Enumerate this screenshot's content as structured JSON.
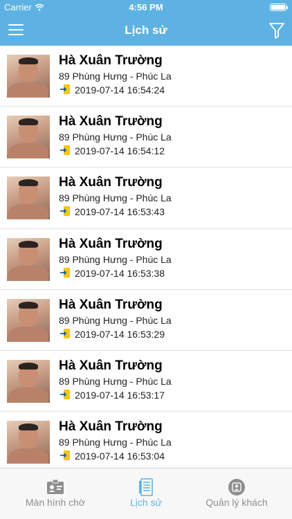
{
  "status_bar": {
    "carrier": "Carrier",
    "time": "4:56 PM"
  },
  "nav": {
    "title": "Lịch sử",
    "menu_icon": "hamburger-menu-icon",
    "filter_icon": "filter-funnel-icon"
  },
  "history": [
    {
      "name": "Hà Xuân Trường",
      "address": "89 Phùng Hưng - Phúc La",
      "time": "2019-07-14 16:54:24"
    },
    {
      "name": "Hà Xuân Trường",
      "address": "89 Phùng Hưng - Phúc La",
      "time": "2019-07-14 16:54:12"
    },
    {
      "name": "Hà Xuân Trường",
      "address": "89 Phùng Hưng - Phúc La",
      "time": "2019-07-14 16:53:43"
    },
    {
      "name": "Hà Xuân Trường",
      "address": "89 Phùng Hưng - Phúc La",
      "time": "2019-07-14 16:53:38"
    },
    {
      "name": "Hà Xuân Trường",
      "address": "89 Phùng Hưng - Phúc La",
      "time": "2019-07-14 16:53:29"
    },
    {
      "name": "Hà Xuân Trường",
      "address": "89 Phùng Hưng - Phúc La",
      "time": "2019-07-14 16:53:17"
    },
    {
      "name": "Hà Xuân Trường",
      "address": "89 Phùng Hưng - Phúc La",
      "time": "2019-07-14 16:53:04"
    }
  ],
  "tabs": [
    {
      "label": "Màn hình chờ",
      "icon": "id-card-icon",
      "active": false
    },
    {
      "label": "Lịch sử",
      "icon": "document-list-icon",
      "active": true
    },
    {
      "label": "Quản lý khách",
      "icon": "contact-badge-icon",
      "active": false
    }
  ],
  "colors": {
    "primary": "#5eb2e3",
    "checkin_icon": "#f5c518",
    "tab_inactive": "#8e8e8e"
  }
}
